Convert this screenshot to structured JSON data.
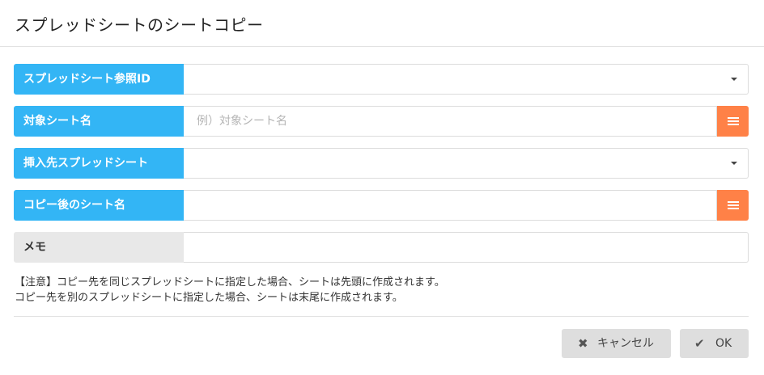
{
  "dialog": {
    "title": "スプレッドシートのシートコピー"
  },
  "fields": {
    "spreadsheet_id": {
      "label": "スプレッドシート参照ID",
      "value": ""
    },
    "target_sheet": {
      "label": "対象シート名",
      "value": "",
      "placeholder": "例）対象シート名"
    },
    "insert_spreadsheet": {
      "label": "挿入先スプレッドシート",
      "value": ""
    },
    "copied_sheet_name": {
      "label": "コピー後のシート名",
      "value": ""
    },
    "memo": {
      "label": "メモ",
      "value": ""
    }
  },
  "note": {
    "line1": "【注意】コピー先を同じスプレッドシートに指定した場合、シートは先頭に作成されます。",
    "line2": "コピー先を別のスプレッドシートに指定した場合、シートは末尾に作成されます。"
  },
  "footer": {
    "cancel_label": "キャンセル",
    "ok_label": "OK"
  },
  "icons": {
    "cancel": "close-icon",
    "ok": "check-icon",
    "dropdown": "chevron-down-icon",
    "list": "list-icon"
  },
  "colors": {
    "label_blue": "#33b5f5",
    "label_gray": "#e8e8e8",
    "list_button_orange": "#ff8147",
    "footer_button": "#dedede"
  }
}
